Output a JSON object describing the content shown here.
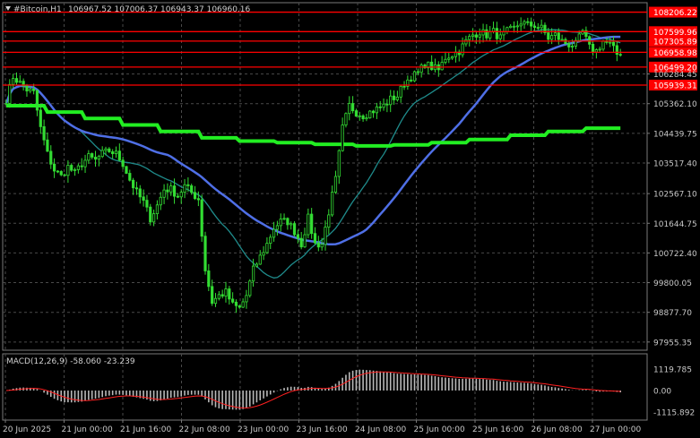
{
  "header": {
    "symbol_label": "#Bitcoin,H1",
    "ohlc": "106967.52 107006.37 106943.37 106960.16"
  },
  "price_axis": {
    "ticks": [
      "106284.45",
      "105362.10",
      "104439.75",
      "103517.40",
      "102567.10",
      "101644.75",
      "100722.40",
      "99800.05",
      "98877.70",
      "97955.35"
    ],
    "tick_values": [
      106284.45,
      105362.1,
      104439.75,
      103517.4,
      102567.1,
      101644.75,
      100722.4,
      99800.05,
      98877.7,
      97955.35
    ],
    "range": [
      97700,
      108500
    ]
  },
  "levels": [
    {
      "label": "108206.22",
      "value": 108206.22
    },
    {
      "label": "107599.96",
      "value": 107599.96
    },
    {
      "label": "107305.89",
      "value": 107305.89
    },
    {
      "label": "106958.98",
      "value": 106958.98
    },
    {
      "label": "106499.20",
      "value": 106499.2
    },
    {
      "label": "105939.31",
      "value": 105939.31
    }
  ],
  "macd": {
    "label": "MACD(12,26,9) -58.060 -23.239",
    "ticks": [
      "1119.785",
      "0.00",
      "-1115.892"
    ],
    "tick_values": [
      1119.785,
      0,
      -1115.892
    ]
  },
  "time_axis": {
    "labels": [
      "20 Jun 2025",
      "21 Jun 00:00",
      "21 Jun 16:00",
      "22 Jun 08:00",
      "23 Jun 00:00",
      "23 Jun 16:00",
      "24 Jun 08:00",
      "25 Jun 00:00",
      "25 Jun 16:00",
      "26 Jun 08:00",
      "27 Jun 00:00"
    ]
  },
  "colors": {
    "background": "#000000",
    "candle": "#33dd33",
    "level_line": "#ff0000",
    "level_badge": "#ff0000",
    "ma_slow": "#22ee22",
    "ma_mid": "#4f6fe6",
    "ma_fast": "#1f8b8b",
    "macd_hist": "#b8b8b8",
    "macd_signal": "#ff2020",
    "text": "#d0d0d0"
  },
  "chart_data": {
    "type": "candlestick",
    "symbol": "#Bitcoin",
    "timeframe": "H1",
    "ylim": [
      97700,
      108500
    ],
    "close_path_points": [
      [
        0,
        105500
      ],
      [
        2,
        106200
      ],
      [
        4,
        106000
      ],
      [
        6,
        105800
      ],
      [
        8,
        105700
      ],
      [
        10,
        104600
      ],
      [
        12,
        103800
      ],
      [
        14,
        103300
      ],
      [
        16,
        103100
      ],
      [
        18,
        103400
      ],
      [
        20,
        103200
      ],
      [
        22,
        103500
      ],
      [
        24,
        103700
      ],
      [
        26,
        103600
      ],
      [
        28,
        103800
      ],
      [
        30,
        103900
      ],
      [
        32,
        103800
      ],
      [
        34,
        103500
      ],
      [
        36,
        103000
      ],
      [
        38,
        102600
      ],
      [
        40,
        102300
      ],
      [
        42,
        101800
      ],
      [
        44,
        102200
      ],
      [
        46,
        102700
      ],
      [
        48,
        102700
      ],
      [
        50,
        102500
      ],
      [
        52,
        102800
      ],
      [
        54,
        102600
      ],
      [
        56,
        102400
      ],
      [
        58,
        100200
      ],
      [
        60,
        99200
      ],
      [
        62,
        99400
      ],
      [
        64,
        99500
      ],
      [
        66,
        99100
      ],
      [
        68,
        99000
      ],
      [
        70,
        99400
      ],
      [
        72,
        100200
      ],
      [
        74,
        100600
      ],
      [
        76,
        101000
      ],
      [
        78,
        101500
      ],
      [
        80,
        101700
      ],
      [
        82,
        101700
      ],
      [
        84,
        101400
      ],
      [
        86,
        101000
      ],
      [
        88,
        101800
      ],
      [
        90,
        101000
      ],
      [
        92,
        101000
      ],
      [
        94,
        102000
      ],
      [
        96,
        103000
      ],
      [
        98,
        104600
      ],
      [
        100,
        105300
      ],
      [
        102,
        105100
      ],
      [
        104,
        105000
      ],
      [
        106,
        105100
      ],
      [
        108,
        105200
      ],
      [
        110,
        105300
      ],
      [
        112,
        105500
      ],
      [
        114,
        105600
      ],
      [
        116,
        106000
      ],
      [
        118,
        106200
      ],
      [
        120,
        106300
      ],
      [
        122,
        106600
      ],
      [
        124,
        106500
      ],
      [
        126,
        106400
      ],
      [
        128,
        106800
      ],
      [
        130,
        106900
      ],
      [
        132,
        107000
      ],
      [
        134,
        107300
      ],
      [
        136,
        107500
      ],
      [
        138,
        107600
      ],
      [
        140,
        107500
      ],
      [
        142,
        107600
      ],
      [
        144,
        107400
      ],
      [
        146,
        107600
      ],
      [
        148,
        107700
      ],
      [
        150,
        107900
      ],
      [
        152,
        107800
      ],
      [
        154,
        107800
      ],
      [
        156,
        107700
      ],
      [
        158,
        107400
      ],
      [
        160,
        107500
      ],
      [
        162,
        107300
      ],
      [
        164,
        107200
      ],
      [
        166,
        107200
      ],
      [
        168,
        107600
      ],
      [
        170,
        107100
      ],
      [
        172,
        107000
      ],
      [
        174,
        107300
      ],
      [
        176,
        107200
      ],
      [
        178,
        106900
      ],
      [
        180,
        107000
      ]
    ]
  }
}
